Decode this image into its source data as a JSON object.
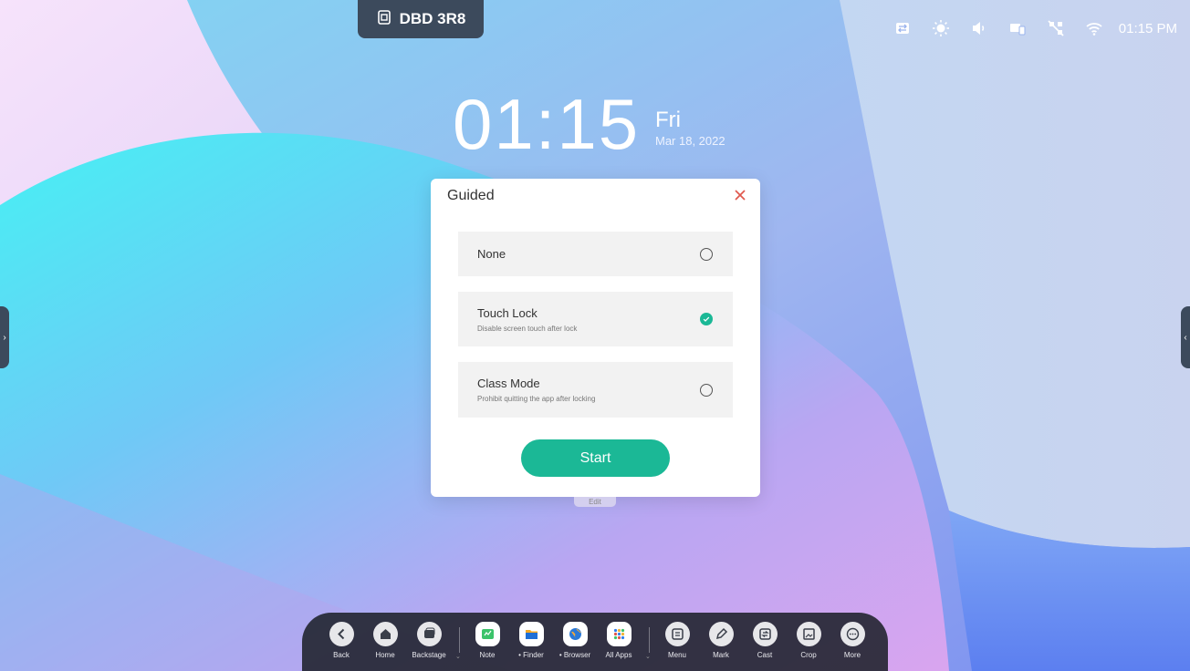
{
  "device_badge": {
    "label": "DBD 3R8",
    "icon": "cast-code-icon"
  },
  "status_bar": {
    "icons": [
      "transfer-icon",
      "brightness-icon",
      "volume-icon",
      "screen-share-icon",
      "network-off-icon",
      "wifi-icon"
    ],
    "time": "01:15 PM"
  },
  "clock": {
    "time": "01:15",
    "day": "Fri",
    "date": "Mar 18, 2022"
  },
  "dialog": {
    "title": "Guided",
    "options": [
      {
        "label": "None",
        "description": "",
        "selected": false
      },
      {
        "label": "Touch Lock",
        "description": "Disable screen touch after lock",
        "selected": true
      },
      {
        "label": "Class Mode",
        "description": "Prohibit quitting the app after locking",
        "selected": false
      }
    ],
    "start_label": "Start",
    "accent": "#1bb896"
  },
  "edit_tab": {
    "label": "Edit"
  },
  "side_handles": {
    "left": "›",
    "right": "‹"
  },
  "dock": {
    "items": [
      {
        "label": "Back",
        "icon": "back-arrow-icon"
      },
      {
        "label": "Home",
        "icon": "home-icon"
      },
      {
        "label": "Backstage",
        "icon": "backstage-icon"
      },
      {
        "label": "Note",
        "icon": "note-icon"
      },
      {
        "label": "• Finder",
        "icon": "folder-icon"
      },
      {
        "label": "• Browser",
        "icon": "browser-icon"
      },
      {
        "label": "All Apps",
        "icon": "apps-grid-icon"
      },
      {
        "label": "Menu",
        "icon": "menu-icon"
      },
      {
        "label": "Mark",
        "icon": "pen-icon"
      },
      {
        "label": "Cast",
        "icon": "cast-icon"
      },
      {
        "label": "Crop",
        "icon": "crop-icon"
      },
      {
        "label": "More",
        "icon": "more-icon"
      }
    ]
  }
}
